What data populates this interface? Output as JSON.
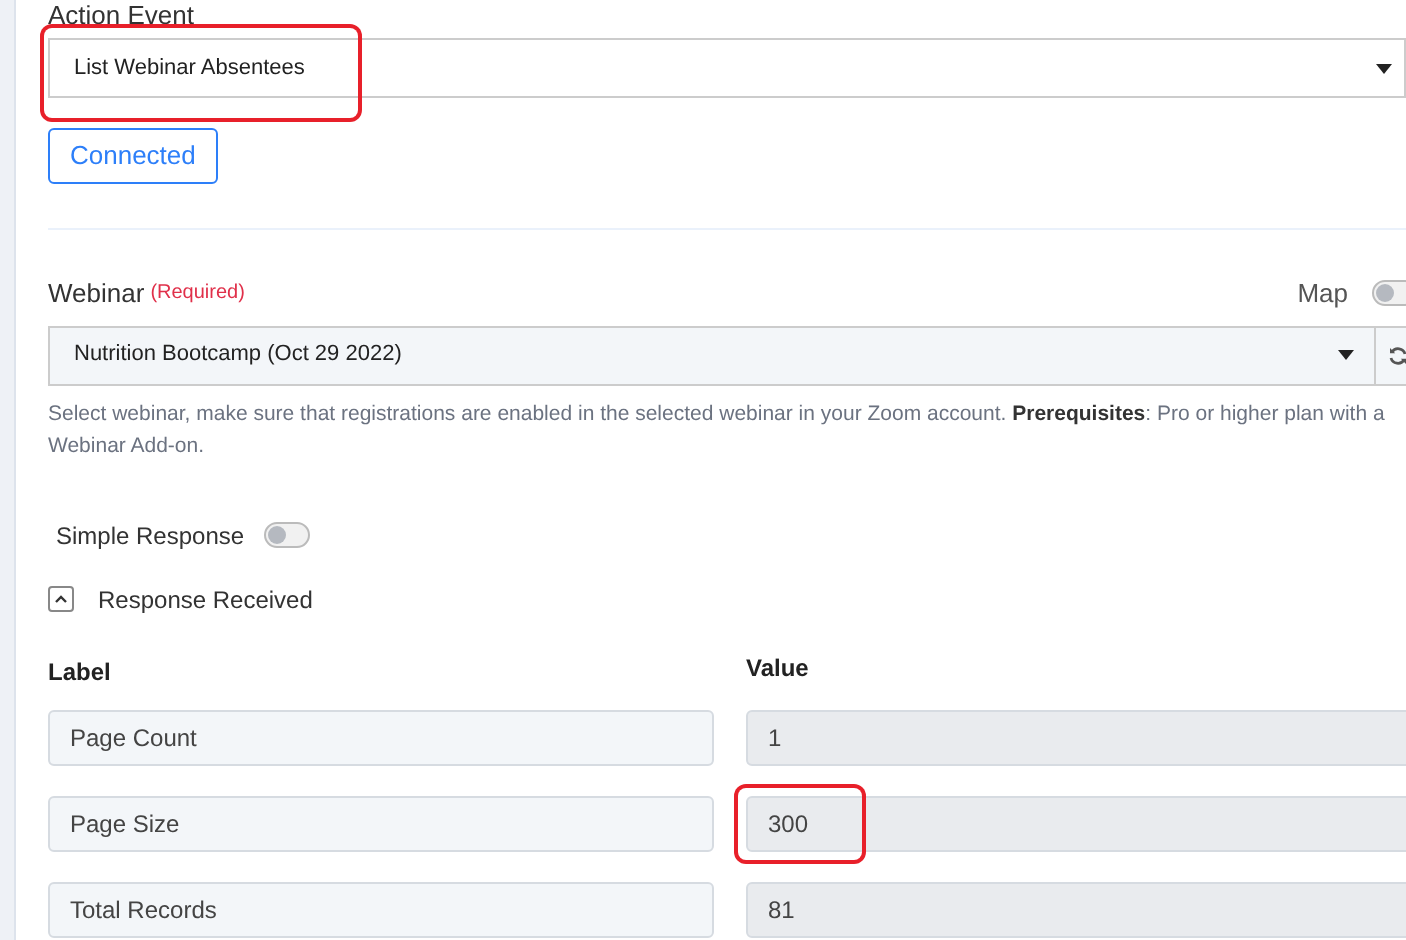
{
  "action_event": {
    "label": "Action Event",
    "value": "List Webinar Absentees",
    "highlighted": true
  },
  "connected_button": "Connected",
  "webinar": {
    "label": "Webinar",
    "required": "(Required)",
    "map_label": "Map",
    "map_on": false,
    "value": "Nutrition Bootcamp (Oct 29 2022)",
    "help": "Select webinar, make sure that registrations are enabled in the selected webinar in your Zoom account. **Prerequisites**: Pro or higher plan with a Webinar Add-on."
  },
  "simple_response": {
    "label": "Simple Response",
    "on": false
  },
  "response_received": {
    "title": "Response Received",
    "expanded": true
  },
  "table": {
    "columns": [
      "Label",
      "Value"
    ],
    "rows": [
      {
        "label": "Page Count",
        "value": "1",
        "highlighted": false
      },
      {
        "label": "Page Size",
        "value": "300",
        "highlighted": true
      },
      {
        "label": "Total Records",
        "value": "81",
        "highlighted": false
      }
    ]
  }
}
